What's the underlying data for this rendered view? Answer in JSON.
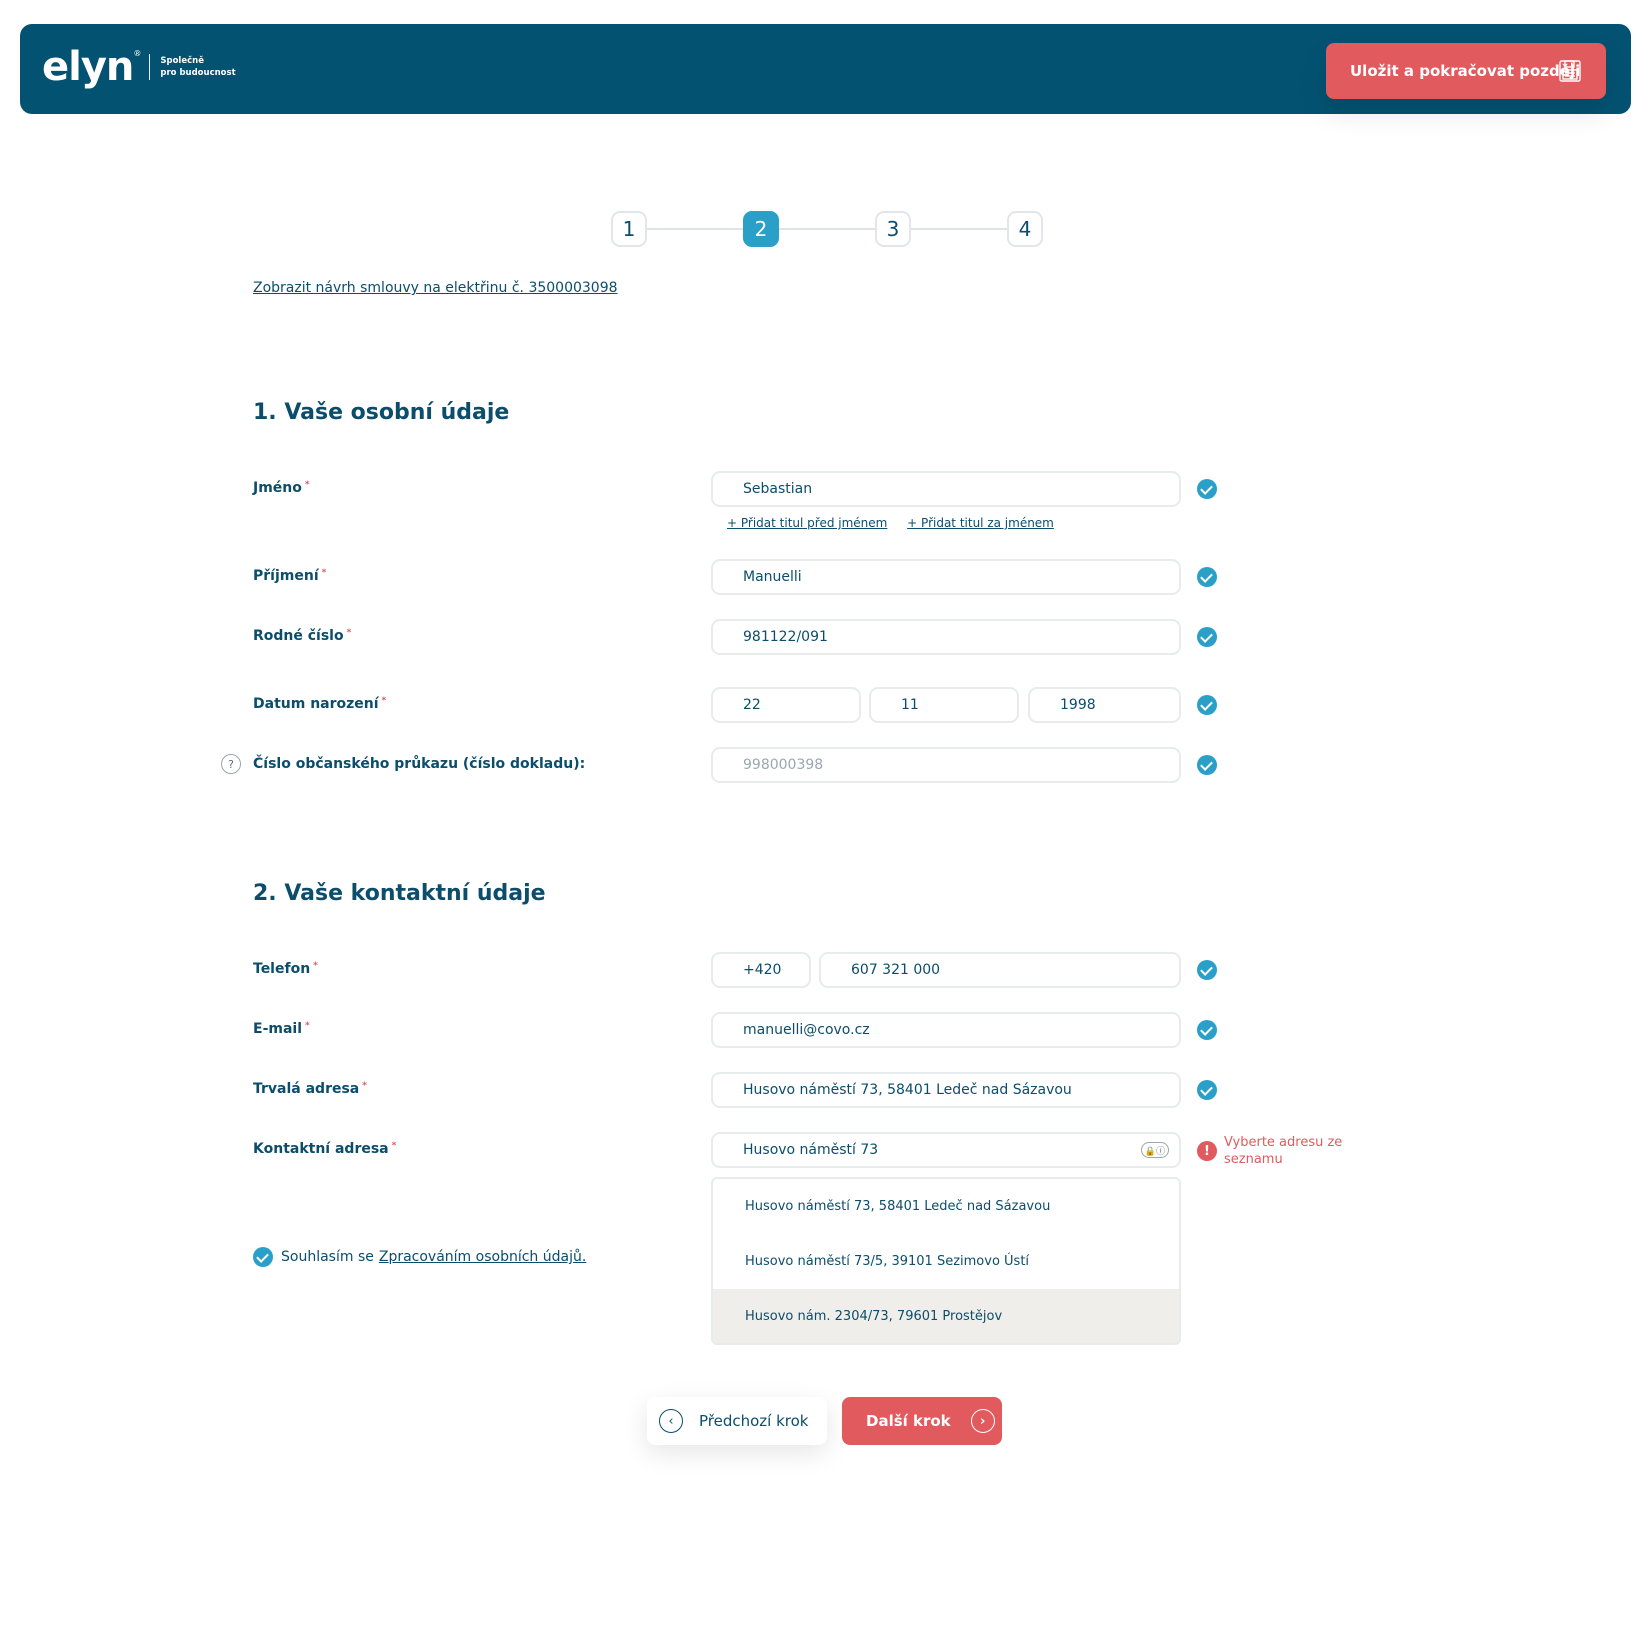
{
  "header": {
    "logo_text": "elyn",
    "logo_reg": "®",
    "tagline_line1": "Společně",
    "tagline_line2": "pro budoucnost",
    "save_label": "Uložit a pokračovat později",
    "save_icon": "floppy-disk-icon",
    "colors": {
      "bar": "#045272",
      "accent": "#e05a5e"
    }
  },
  "stepper": {
    "steps": [
      "1",
      "2",
      "3",
      "4"
    ],
    "active": 2
  },
  "contract_link": "Zobrazit návrh smlouvy na elektřinu č. 3500003098",
  "personal": {
    "title": "1. Vaše osobní údaje",
    "first_name": {
      "label": "Jméno",
      "value": "Sebastian"
    },
    "add_title_before": "+ Přidat titul před jménem",
    "add_title_after": "+ Přidat titul za jménem",
    "last_name": {
      "label": "Příjmení",
      "value": "Manuelli"
    },
    "birth_number": {
      "label": "Rodné číslo",
      "value": "981122/091"
    },
    "birth_date": {
      "label": "Datum narození",
      "day": "22",
      "month": "11",
      "year": "1998"
    },
    "id_card": {
      "label": "Číslo občanského průkazu (číslo dokladu):",
      "placeholder": "998000398",
      "help": "?"
    }
  },
  "contact": {
    "title": "2. Vaše kontaktní údaje",
    "phone": {
      "label": "Telefon",
      "prefix": "+420",
      "value": "607 321 000"
    },
    "email": {
      "label": "E-mail",
      "value": "manuelli@covo.cz"
    },
    "permanent_address": {
      "label": "Trvalá adresa",
      "value": "Husovo náměstí 73, 58401 Ledeč nad Sázavou"
    },
    "contact_address": {
      "label": "Kontaktní adresa",
      "value": "Husovo náměstí 73",
      "error": "Vyberte adresu ze seznamu",
      "error_icon": "!",
      "suggestions": [
        "Husovo náměstí 73, 58401 Ledeč nad Sázavou",
        "Husovo náměstí 73/5, 39101 Sezimovo Ústí",
        "Husovo nám. 2304/73, 79601 Prostějov"
      ]
    }
  },
  "required_mark": "*",
  "consent": {
    "prefix": "Souhlasím se",
    "link": "Zpracováním osobních údajů."
  },
  "nav": {
    "prev_label": "Předchozí krok",
    "next_label": "Další krok",
    "prev_icon": "‹",
    "next_icon": "›"
  }
}
